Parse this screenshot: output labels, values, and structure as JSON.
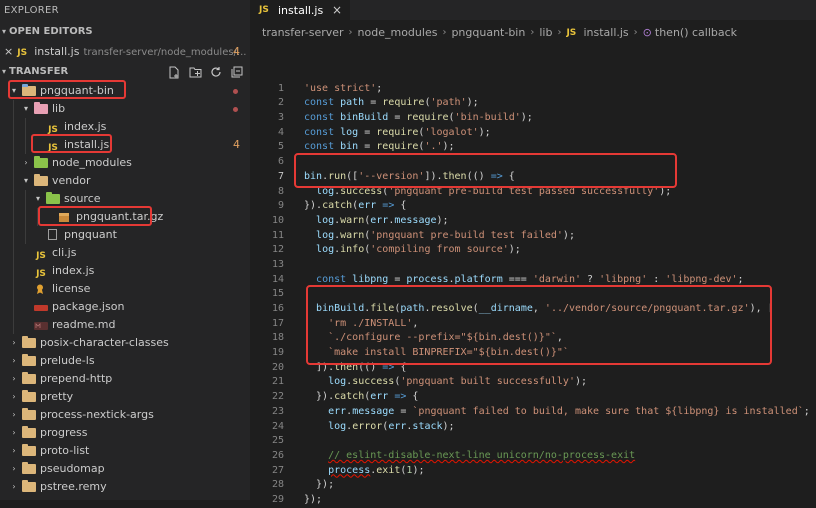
{
  "explorer": {
    "title": "EXPLORER",
    "open_editors": {
      "header": "OPEN EDITORS",
      "item": {
        "close": "×",
        "icon": "JS",
        "name": "install.js",
        "path": "transfer-server/node_modules/...",
        "badge": "4"
      }
    },
    "project": {
      "header": "TRANSFER",
      "rows": [
        {
          "label": "pngquant-bin",
          "icon": "folder-open",
          "chevron": "▾",
          "indent": 0,
          "dot": true
        },
        {
          "label": "lib",
          "icon": "folder-lib",
          "chevron": "▾",
          "indent": 1,
          "dot": true
        },
        {
          "label": "index.js",
          "icon": "js",
          "chevron": "",
          "indent": 2
        },
        {
          "label": "install.js",
          "icon": "js",
          "chevron": "",
          "indent": 2,
          "badge": "4"
        },
        {
          "label": "node_modules",
          "icon": "folder-green",
          "chevron": "›",
          "indent": 1
        },
        {
          "label": "vendor",
          "icon": "folder",
          "chevron": "▾",
          "indent": 1
        },
        {
          "label": "source",
          "icon": "folder-green",
          "chevron": "▾",
          "indent": 2
        },
        {
          "label": "pngquant.tar.gz",
          "icon": "archive",
          "chevron": "",
          "indent": 3
        },
        {
          "label": "pngquant",
          "icon": "file",
          "chevron": "",
          "indent": 2
        },
        {
          "label": "cli.js",
          "icon": "js",
          "chevron": "",
          "indent": 1
        },
        {
          "label": "index.js",
          "icon": "js",
          "chevron": "",
          "indent": 1
        },
        {
          "label": "license",
          "icon": "license",
          "chevron": "",
          "indent": 1
        },
        {
          "label": "package.json",
          "icon": "json",
          "chevron": "",
          "indent": 1
        },
        {
          "label": "readme.md",
          "icon": "md",
          "chevron": "",
          "indent": 1
        },
        {
          "label": "posix-character-classes",
          "icon": "folder",
          "chevron": "›",
          "indent": 0
        },
        {
          "label": "prelude-ls",
          "icon": "folder",
          "chevron": "›",
          "indent": 0
        },
        {
          "label": "prepend-http",
          "icon": "folder",
          "chevron": "›",
          "indent": 0
        },
        {
          "label": "pretty",
          "icon": "folder",
          "chevron": "›",
          "indent": 0
        },
        {
          "label": "process-nextick-args",
          "icon": "folder",
          "chevron": "›",
          "indent": 0
        },
        {
          "label": "progress",
          "icon": "folder",
          "chevron": "›",
          "indent": 0
        },
        {
          "label": "proto-list",
          "icon": "folder",
          "chevron": "›",
          "indent": 0
        },
        {
          "label": "pseudomap",
          "icon": "folder",
          "chevron": "›",
          "indent": 0
        },
        {
          "label": "pstree.remy",
          "icon": "folder",
          "chevron": "›",
          "indent": 0
        }
      ]
    }
  },
  "editor": {
    "tab": {
      "icon": "JS",
      "label": "install.js",
      "close": "×"
    },
    "breadcrumb": {
      "parts": [
        "transfer-server",
        "node_modules",
        "pngquant-bin",
        "lib"
      ],
      "file_icon": "JS",
      "file": "install.js",
      "symbol_icon": "⊙",
      "symbol": "then() callback"
    },
    "current_line": 7,
    "lines": [
      {
        "n": "",
        "segs": []
      },
      {
        "n": "1",
        "segs": [
          [
            "str",
            "'use strict'"
          ],
          [
            "",
            ";"
          ]
        ]
      },
      {
        "n": "2",
        "segs": [
          [
            "kw",
            "const "
          ],
          [
            "vr",
            "path"
          ],
          [
            "",
            " = "
          ],
          [
            "fn",
            "require"
          ],
          [
            "",
            "("
          ],
          [
            "str",
            "'path'"
          ],
          [
            "",
            ");"
          ]
        ]
      },
      {
        "n": "3",
        "segs": [
          [
            "kw",
            "const "
          ],
          [
            "vr",
            "binBuild"
          ],
          [
            "",
            " = "
          ],
          [
            "fn",
            "require"
          ],
          [
            "",
            "("
          ],
          [
            "str",
            "'bin-build'"
          ],
          [
            "",
            ");"
          ]
        ]
      },
      {
        "n": "4",
        "segs": [
          [
            "kw",
            "const "
          ],
          [
            "vr",
            "log"
          ],
          [
            "",
            " = "
          ],
          [
            "fn",
            "require"
          ],
          [
            "",
            "("
          ],
          [
            "str",
            "'logalot'"
          ],
          [
            "",
            ");"
          ]
        ]
      },
      {
        "n": "5",
        "segs": [
          [
            "kw",
            "const "
          ],
          [
            "vr",
            "bin"
          ],
          [
            "",
            " = "
          ],
          [
            "fn",
            "require"
          ],
          [
            "",
            "("
          ],
          [
            "str",
            "'.'"
          ],
          [
            "",
            ");"
          ]
        ]
      },
      {
        "n": "6",
        "segs": []
      },
      {
        "n": "7",
        "segs": [
          [
            "vr",
            "bin"
          ],
          [
            "",
            "."
          ],
          [
            "fn",
            "run"
          ],
          [
            "",
            "(["
          ],
          [
            "str",
            "'--version'"
          ],
          [
            "",
            "])."
          ],
          [
            "fn",
            "then"
          ],
          [
            "",
            "(() "
          ],
          [
            "kw",
            "=>"
          ],
          [
            "",
            " {"
          ]
        ]
      },
      {
        "n": "8",
        "segs": [
          [
            "",
            "  "
          ],
          [
            "vr",
            "log"
          ],
          [
            "",
            "."
          ],
          [
            "fn",
            "success"
          ],
          [
            "",
            "("
          ],
          [
            "str",
            "'pngquant pre-build test passed successfully'"
          ],
          [
            "",
            ");"
          ]
        ]
      },
      {
        "n": "9",
        "segs": [
          [
            "",
            "})."
          ],
          [
            "fn",
            "catch"
          ],
          [
            "",
            "("
          ],
          [
            "vr",
            "err"
          ],
          [
            "",
            " "
          ],
          [
            "kw",
            "=>"
          ],
          [
            "",
            " {"
          ]
        ]
      },
      {
        "n": "10",
        "segs": [
          [
            "",
            "  "
          ],
          [
            "vr",
            "log"
          ],
          [
            "",
            "."
          ],
          [
            "fn",
            "warn"
          ],
          [
            "",
            "("
          ],
          [
            "vr",
            "err"
          ],
          [
            "",
            "."
          ],
          [
            "vr",
            "message"
          ],
          [
            "",
            ");"
          ]
        ]
      },
      {
        "n": "11",
        "segs": [
          [
            "",
            "  "
          ],
          [
            "vr",
            "log"
          ],
          [
            "",
            "."
          ],
          [
            "fn",
            "warn"
          ],
          [
            "",
            "("
          ],
          [
            "str",
            "'pngquant pre-build test failed'"
          ],
          [
            "",
            ");"
          ]
        ]
      },
      {
        "n": "12",
        "segs": [
          [
            "",
            "  "
          ],
          [
            "vr",
            "log"
          ],
          [
            "",
            "."
          ],
          [
            "fn",
            "info"
          ],
          [
            "",
            "("
          ],
          [
            "str",
            "'compiling from source'"
          ],
          [
            "",
            ");"
          ]
        ]
      },
      {
        "n": "13",
        "segs": []
      },
      {
        "n": "14",
        "segs": [
          [
            "",
            "  "
          ],
          [
            "kw",
            "const "
          ],
          [
            "vr",
            "libpng"
          ],
          [
            "",
            " = "
          ],
          [
            "vr",
            "process"
          ],
          [
            "",
            "."
          ],
          [
            "vr",
            "platform"
          ],
          [
            "",
            " === "
          ],
          [
            "str",
            "'darwin'"
          ],
          [
            "",
            " ? "
          ],
          [
            "str",
            "'libpng'"
          ],
          [
            "",
            " : "
          ],
          [
            "str",
            "'libpng-dev'"
          ],
          [
            "",
            ";"
          ]
        ]
      },
      {
        "n": "15",
        "segs": []
      },
      {
        "n": "16",
        "segs": [
          [
            "",
            "  "
          ],
          [
            "vr",
            "binBuild"
          ],
          [
            "",
            "."
          ],
          [
            "fn",
            "file"
          ],
          [
            "",
            "("
          ],
          [
            "vr",
            "path"
          ],
          [
            "",
            "."
          ],
          [
            "fn",
            "resolve"
          ],
          [
            "",
            "("
          ],
          [
            "vr",
            "__dirname"
          ],
          [
            "",
            ", "
          ],
          [
            "str",
            "'../vendor/source/pngquant.tar.gz'"
          ],
          [
            "",
            "), ["
          ]
        ]
      },
      {
        "n": "17",
        "segs": [
          [
            "",
            "    "
          ],
          [
            "str",
            "'rm ./INSTALL'"
          ],
          [
            "",
            ","
          ]
        ]
      },
      {
        "n": "18",
        "segs": [
          [
            "",
            "    "
          ],
          [
            "str",
            "`./configure --prefix=\"${bin.dest()}\"`"
          ],
          [
            "",
            ","
          ]
        ]
      },
      {
        "n": "19",
        "segs": [
          [
            "",
            "    "
          ],
          [
            "str",
            "`make install BINPREFIX=\"${bin.dest()}\"`"
          ]
        ]
      },
      {
        "n": "20",
        "segs": [
          [
            "",
            "  ])."
          ],
          [
            "fn",
            "then"
          ],
          [
            "",
            "(() "
          ],
          [
            "kw",
            "=>"
          ],
          [
            "",
            " {"
          ]
        ]
      },
      {
        "n": "21",
        "segs": [
          [
            "",
            "    "
          ],
          [
            "vr",
            "log"
          ],
          [
            "",
            "."
          ],
          [
            "fn",
            "success"
          ],
          [
            "",
            "("
          ],
          [
            "str",
            "'pngquant built successfully'"
          ],
          [
            "",
            ");"
          ]
        ]
      },
      {
        "n": "22",
        "segs": [
          [
            "",
            "  })."
          ],
          [
            "fn",
            "catch"
          ],
          [
            "",
            "("
          ],
          [
            "vr",
            "err"
          ],
          [
            "",
            " "
          ],
          [
            "kw",
            "=>"
          ],
          [
            "",
            " {"
          ]
        ]
      },
      {
        "n": "23",
        "segs": [
          [
            "",
            "    "
          ],
          [
            "vr",
            "err"
          ],
          [
            "",
            "."
          ],
          [
            "vr",
            "message"
          ],
          [
            "",
            " = "
          ],
          [
            "str",
            "`pngquant failed to build, make sure that ${libpng} is installed`"
          ],
          [
            "",
            ";"
          ]
        ]
      },
      {
        "n": "24",
        "segs": [
          [
            "",
            "    "
          ],
          [
            "vr",
            "log"
          ],
          [
            "",
            "."
          ],
          [
            "fn",
            "error"
          ],
          [
            "",
            "("
          ],
          [
            "vr",
            "err"
          ],
          [
            "",
            "."
          ],
          [
            "vr",
            "stack"
          ],
          [
            "",
            ");"
          ]
        ]
      },
      {
        "n": "25",
        "segs": []
      },
      {
        "n": "26",
        "segs": [
          [
            "",
            "    "
          ],
          [
            "cmt",
            "// eslint-disable-next-line unicorn/no-process-exit"
          ]
        ]
      },
      {
        "n": "27",
        "segs": [
          [
            "",
            "    "
          ],
          [
            "vr",
            "process"
          ],
          [
            "",
            "."
          ],
          [
            "fn",
            "exit"
          ],
          [
            "",
            "("
          ],
          [
            "num",
            "1"
          ],
          [
            "",
            ");"
          ]
        ]
      },
      {
        "n": "28",
        "segs": [
          [
            "",
            "  });"
          ]
        ]
      },
      {
        "n": "29",
        "segs": [
          [
            "",
            "});"
          ]
        ]
      }
    ]
  },
  "colors": {
    "highlight_box": "#e53935",
    "editor_bg": "#1e1e1e",
    "sidebar_bg": "#252526"
  }
}
